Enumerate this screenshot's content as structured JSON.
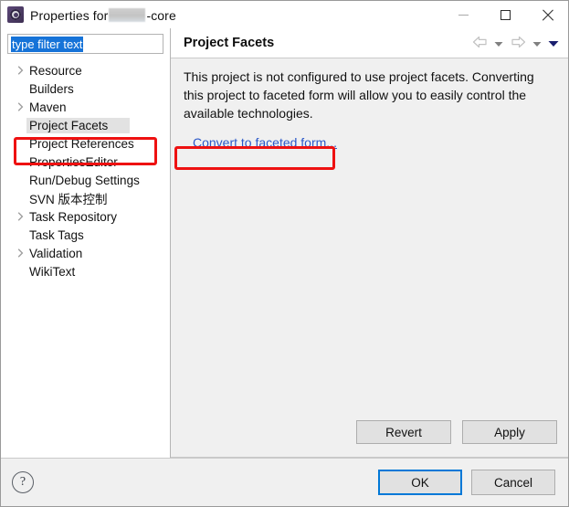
{
  "window": {
    "title_prefix": "Properties for ",
    "title_redacted": true,
    "title_suffix": "-core",
    "app_icon": "eclipse-gear-icon",
    "controls": {
      "minimize": "minimize-icon",
      "maximize": "maximize-icon",
      "close": "close-icon"
    }
  },
  "sidebar": {
    "filter": {
      "value": "type filter text",
      "placeholder": "type filter text",
      "selected": true
    },
    "items": [
      {
        "label": "Resource",
        "expandable": true,
        "selected": false
      },
      {
        "label": "Builders",
        "expandable": false,
        "selected": false
      },
      {
        "label": "Maven",
        "expandable": true,
        "selected": false
      },
      {
        "label": "Project Facets",
        "expandable": false,
        "selected": true
      },
      {
        "label": "Project References",
        "expandable": false,
        "selected": false
      },
      {
        "label": "PropertiesEditor",
        "expandable": false,
        "selected": false
      },
      {
        "label": "Run/Debug Settings",
        "expandable": false,
        "selected": false
      },
      {
        "label": "SVN 版本控制",
        "expandable": false,
        "selected": false
      },
      {
        "label": "Task Repository",
        "expandable": true,
        "selected": false
      },
      {
        "label": "Task Tags",
        "expandable": false,
        "selected": false
      },
      {
        "label": "Validation",
        "expandable": true,
        "selected": false
      },
      {
        "label": "WikiText",
        "expandable": false,
        "selected": false
      }
    ]
  },
  "content": {
    "title": "Project Facets",
    "nav": {
      "back": "back-arrow-icon",
      "back_menu": "back-dropdown-icon",
      "forward": "forward-arrow-icon",
      "forward_menu": "forward-dropdown-icon",
      "view_menu": "view-menu-icon"
    },
    "description": "This project is not configured to use project facets. Converting this project to faceted form will allow you to easily control the available technologies.",
    "link": "Convert to faceted form...",
    "revert_label": "Revert",
    "apply_label": "Apply"
  },
  "footer": {
    "help": "?",
    "ok_label": "OK",
    "cancel_label": "Cancel"
  },
  "annotations": {
    "tree_highlight": "Project Facets",
    "link_highlight": "Convert to faceted form..."
  },
  "colors": {
    "annotation_red": "#ee1111",
    "link_blue": "#2a58c8",
    "selection_blue": "#1673d8",
    "focus_blue": "#0078d7",
    "dialog_gray": "#f0f0f0"
  }
}
